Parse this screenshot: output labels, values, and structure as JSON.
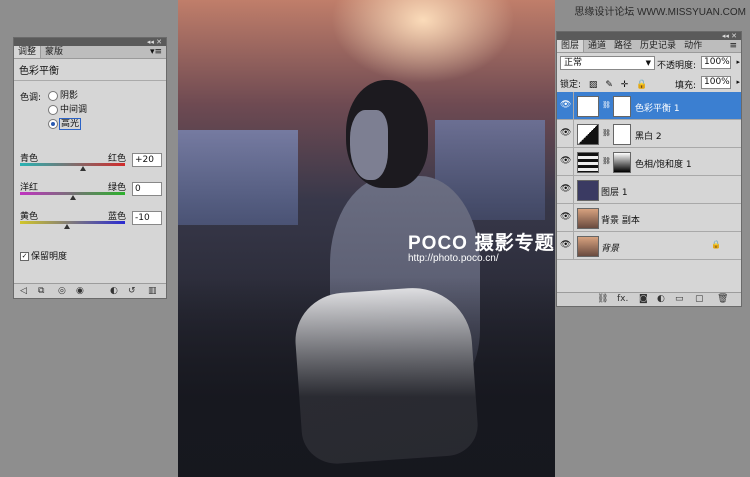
{
  "watermark": "思缘设计论坛 WWW.MISSYUAN.COM",
  "logo": {
    "brand": "POCO",
    "sub": "摄影专题",
    "url": "http://photo.poco.cn/"
  },
  "adjustments": {
    "tabs": [
      "调整",
      "蒙版"
    ],
    "title": "色彩平衡",
    "tone_label": "色调:",
    "tones": [
      "阴影",
      "中间调",
      "高光"
    ],
    "selected_tone": "高光",
    "sliders": [
      {
        "left": "青色",
        "right": "红色",
        "value": "+20",
        "color_left": "#27b3b3",
        "color_right": "#d22b2b",
        "pos": 0.6
      },
      {
        "left": "洋红",
        "right": "绿色",
        "value": "0",
        "color_left": "#c132c1",
        "color_right": "#2bb12b",
        "pos": 0.5
      },
      {
        "left": "黄色",
        "right": "蓝色",
        "value": "-10",
        "color_left": "#d1c62a",
        "color_right": "#2a2ad1",
        "pos": 0.45
      }
    ],
    "preserve_luminosity": "保留明度"
  },
  "layers_panel": {
    "tabs": [
      "图层",
      "通道",
      "路径",
      "历史记录",
      "动作"
    ],
    "blend_mode": "正常",
    "opacity_label": "不透明度:",
    "opacity": "100%",
    "lock_label": "锁定:",
    "fill_label": "填充:",
    "fill": "100%",
    "layers": [
      {
        "name": "色彩平衡 1",
        "selected": true,
        "thumb": "balance-icon",
        "mask": true
      },
      {
        "name": "黑白 2",
        "selected": false,
        "thumb": "bw-icon",
        "mask": true
      },
      {
        "name": "色相/饱和度 1",
        "selected": false,
        "thumb": "hue-icon",
        "mask": true
      },
      {
        "name": "图层 1",
        "selected": false,
        "thumb": "#3a3a62",
        "mask": false
      },
      {
        "name": "背景 副本",
        "selected": false,
        "thumb": "#b0876e",
        "mask": false
      },
      {
        "name": "背景",
        "selected": false,
        "thumb": "#b0876e",
        "mask": false,
        "locked": true
      }
    ]
  }
}
